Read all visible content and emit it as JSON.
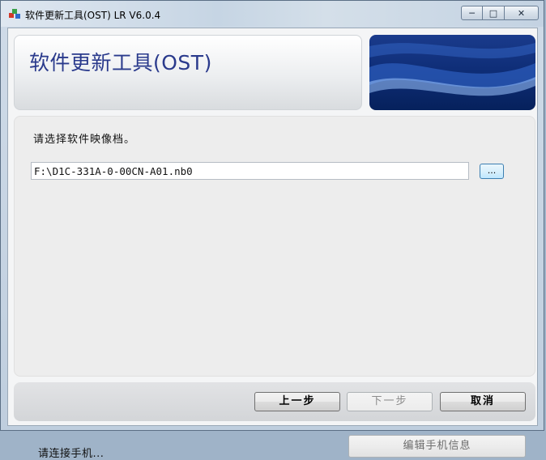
{
  "window": {
    "title": "软件更新工具(OST) LR V6.0.4",
    "controls": {
      "minimize": "─",
      "maximize": "□",
      "close": "✕"
    }
  },
  "banner": {
    "title": "软件更新工具(OST)"
  },
  "main": {
    "prompt": "请选择软件映像档。",
    "file_path": "F:\\D1C-331A-0-00CN-A01.nb0",
    "browse_label": "...",
    "status": "请连接手机...",
    "edit_button": "编辑手机信息"
  },
  "footer": {
    "prev_label": "上一步",
    "next_label": "下一步",
    "cancel_label": "取消"
  },
  "colors": {
    "accent": "#2a3a8c",
    "banner_blue": "#0f2e78"
  },
  "icons": {
    "app": "app-cubes-icon"
  }
}
